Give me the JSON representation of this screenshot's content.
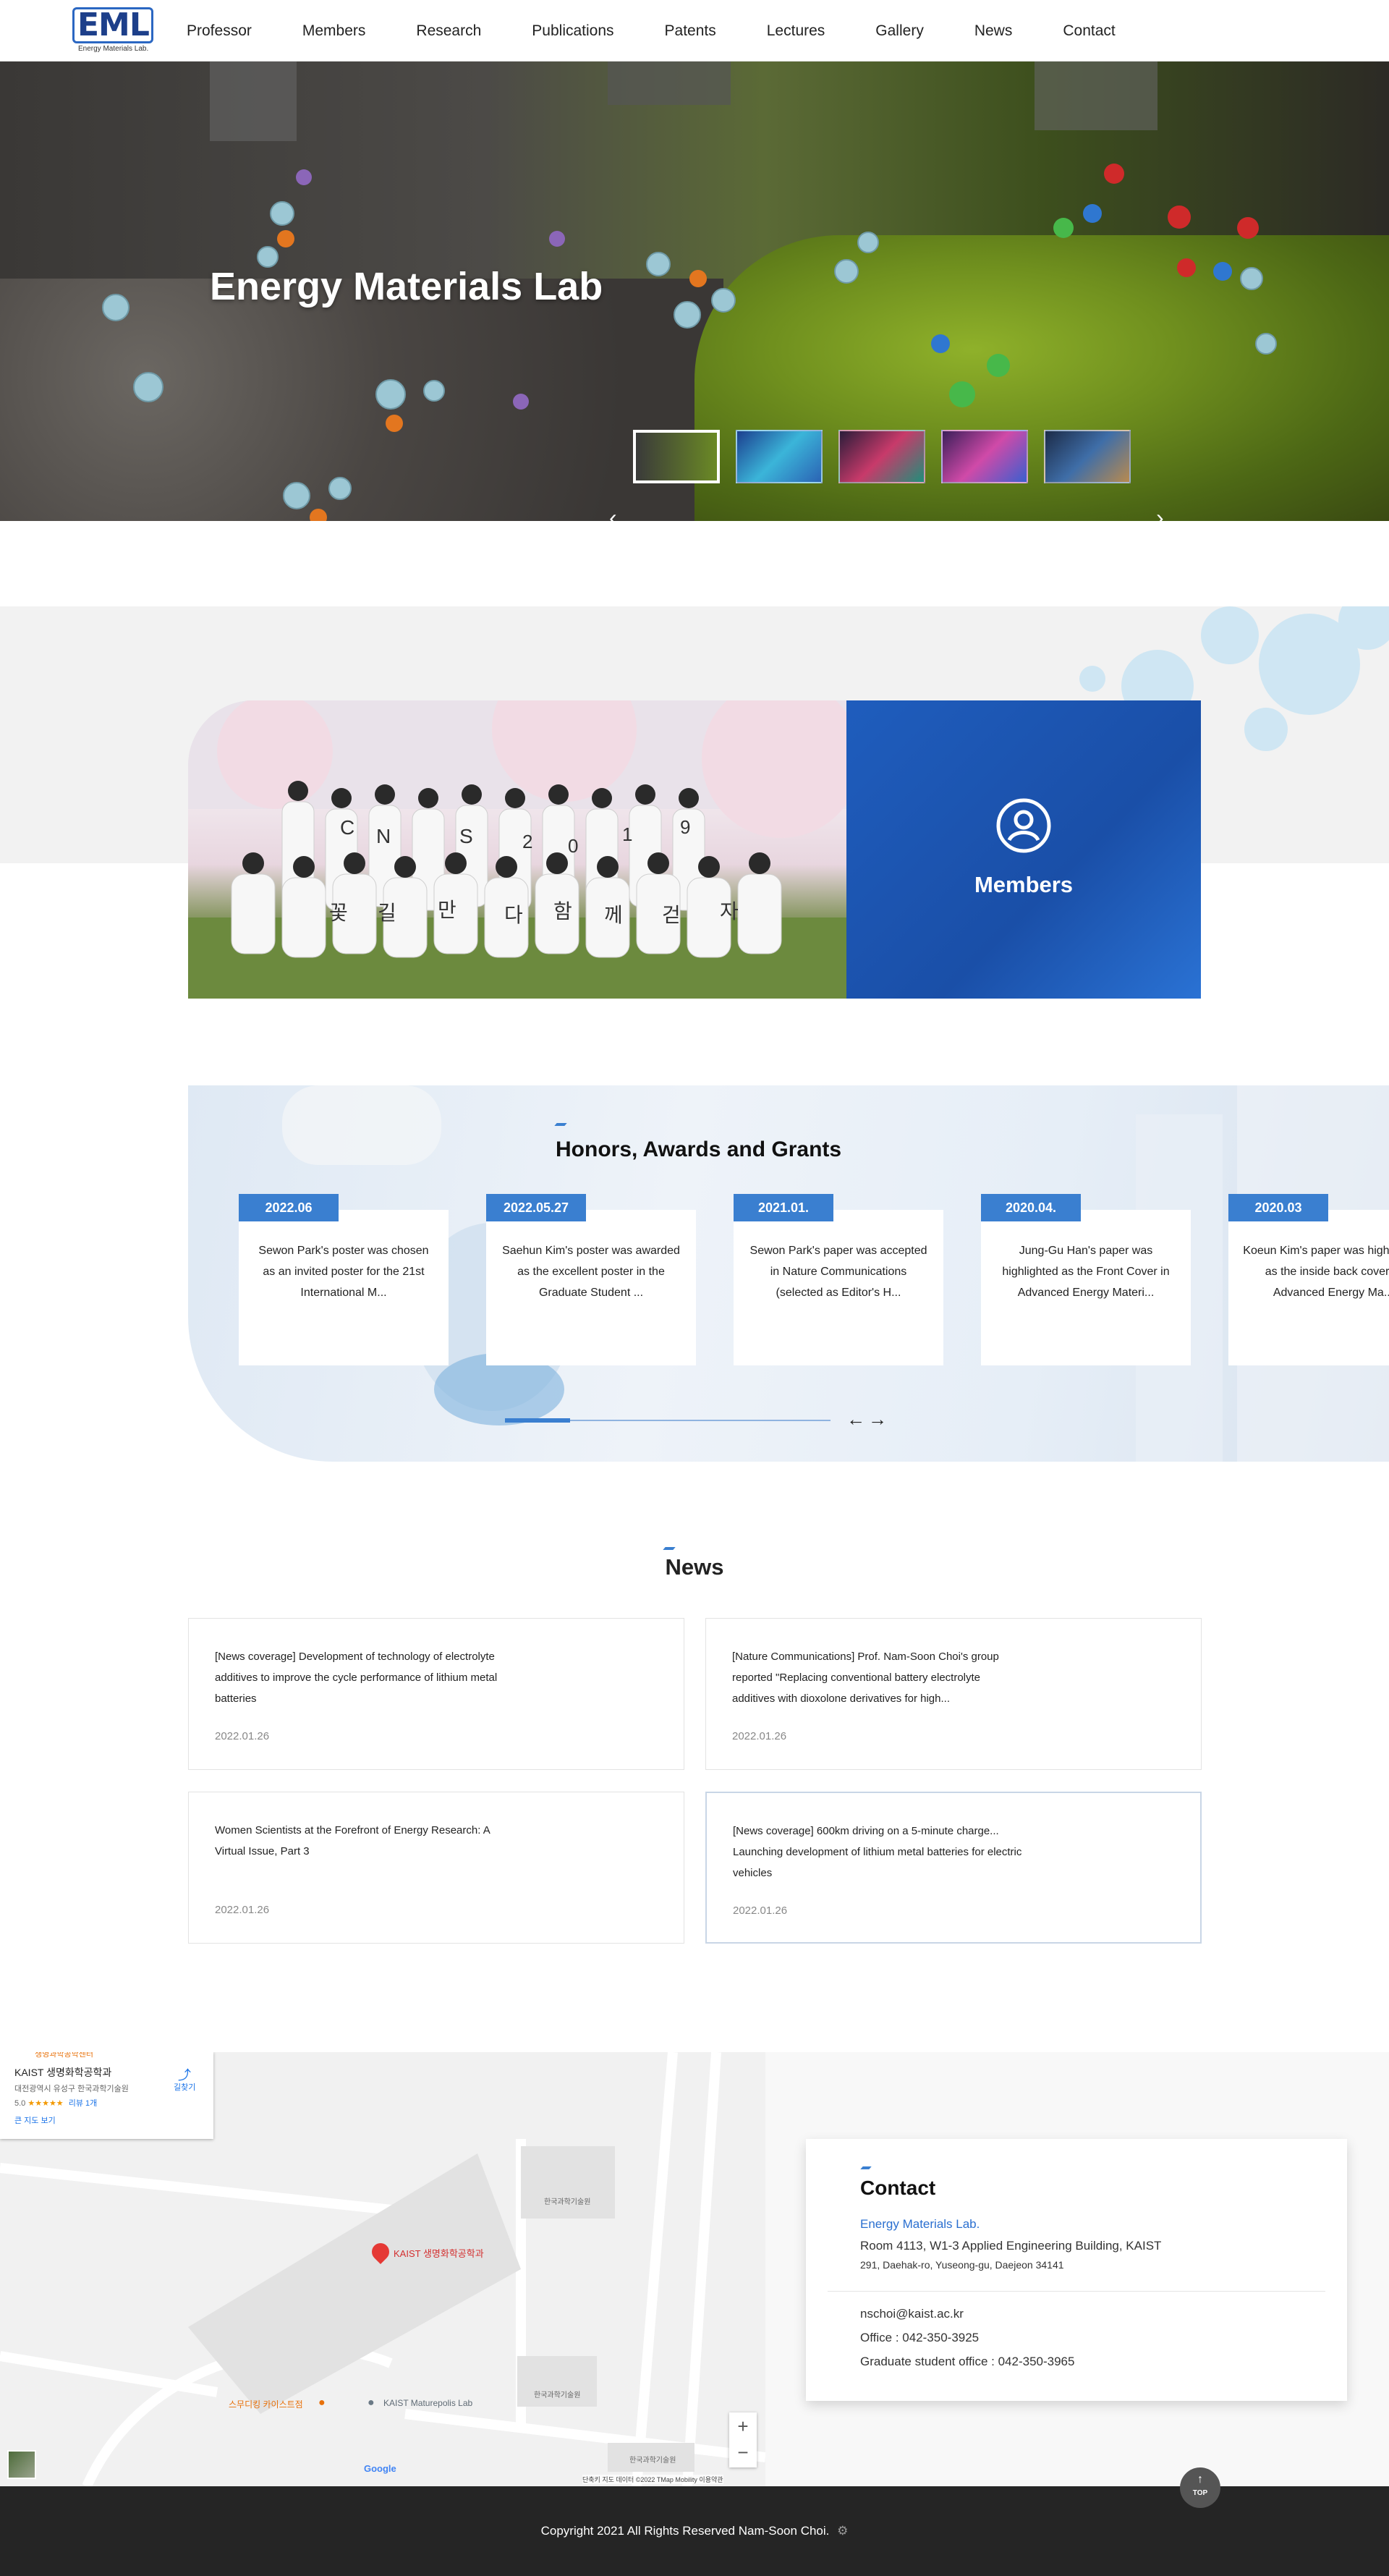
{
  "header": {
    "logo_text": "EML",
    "logo_sub": "Energy Materials Lab.",
    "nav": [
      "Professor",
      "Members",
      "Research",
      "Publications",
      "Patents",
      "Lectures",
      "Gallery",
      "News",
      "Contact"
    ]
  },
  "hero": {
    "title": "Energy Materials Lab",
    "prev_symbol": "‹",
    "next_symbol": "›"
  },
  "members": {
    "label": "Members",
    "photo_signs": [
      "C",
      "N",
      "S",
      "2",
      "0",
      "1",
      "9",
      "꽃",
      "길",
      "만",
      "다",
      "함",
      "께",
      "걷",
      "자"
    ]
  },
  "honors": {
    "title": "Honors, Awards and Grants",
    "items": [
      {
        "date": "2022.06",
        "text": "Sewon Park's poster was chosen as an invited poster for the 21st International M..."
      },
      {
        "date": "2022.05.27",
        "text": "Saehun Kim's poster was awarded as the excellent poster in the Graduate Student ..."
      },
      {
        "date": "2021.01.",
        "text": "Sewon Park's paper was accepted in Nature Communications (selected as Editor's H..."
      },
      {
        "date": "2020.04.",
        "text": "Jung-Gu Han's paper was highlighted as the Front Cover in Advanced Energy Materi..."
      },
      {
        "date": "2020.03",
        "text": "Koeun Kim's paper was highlighted as the inside back cover in Advanced Energy Ma..."
      }
    ],
    "prev_arrow": "←",
    "next_arrow": "→",
    "progress": 0.2
  },
  "news": {
    "title": "News",
    "items": [
      {
        "title": "[News coverage] Development of technology of electrolyte additives to improve the cycle performance of lithium metal batteries",
        "date": "2022.01.26"
      },
      {
        "title": "[Nature Communications] Prof. Nam-Soon Choi's group reported \"Replacing conventional battery electrolyte additives with dioxolone derivatives for high...",
        "date": "2022.01.26"
      },
      {
        "title": "Women Scientists at the Forefront of Energy Research: A Virtual Issue, Part 3",
        "date": "2022.01.26"
      },
      {
        "title": "[News coverage] 600km driving on a 5-minute charge... Launching development of lithium metal batteries for electric vehicles",
        "date": "2022.01.26"
      }
    ]
  },
  "map": {
    "place_name": "KAIST 생명화학공학과",
    "place_address": "대전광역시 유성구 한국과학기술원",
    "rating": "5.0",
    "stars": "★★★★★",
    "reviews": "리뷰 1개",
    "directions": "길찾기",
    "bigger_map": "큰 지도 보기",
    "top_label": "생명과학공학센터",
    "marker_label": "KAIST 생명화학공학과",
    "poi_1": "스무디킹 카이스트점",
    "poi_2": "KAIST Maturepolis Lab",
    "bldg_1": "한국과학기술원",
    "bldg_2": "한국과학기술원",
    "bldg_3": "한국과학기술원",
    "zoom_in": "+",
    "zoom_out": "−",
    "google": "Google",
    "attribution": "단축키   지도 데이터 ©2022 TMap Mobility   이용약관"
  },
  "contact": {
    "title": "Contact",
    "lab": "Energy Materials Lab.",
    "address1": "Room 4113, W1-3 Applied Engineering Building, KAIST",
    "address2": "291, Daehak-ro, Yuseong-gu, Daejeon 34141",
    "email": "nschoi@kaist.ac.kr",
    "office": "Office : 042-350-3925",
    "grad_office": "Graduate student office : 042-350-3965"
  },
  "top_button": "TOP",
  "footer": {
    "copyright": "Copyright 2021 All Rights Reserved Nam-Soon Choi."
  },
  "colors": {
    "accent": "#3a7fd0",
    "members_blue": "#1d56b4",
    "footer": "#252525",
    "map_marker": "#e53935"
  }
}
